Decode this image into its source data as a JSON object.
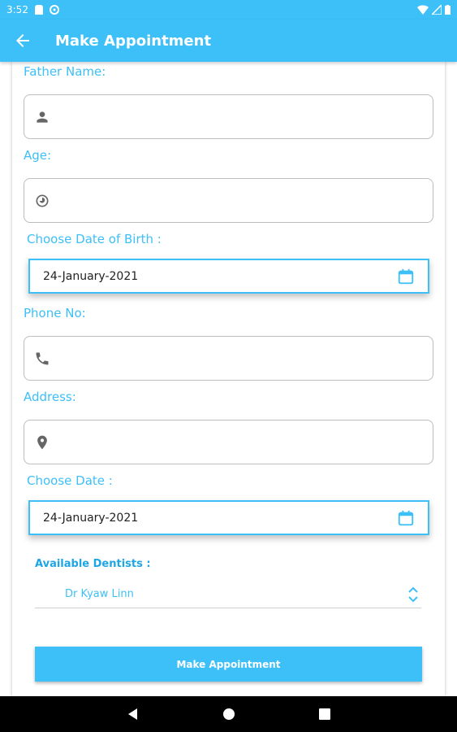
{
  "status_bar": {
    "time": "3:52"
  },
  "app_bar": {
    "title": "Make Appointment",
    "back_icon": "arrow-back-icon"
  },
  "form": {
    "father_name_label": "Father Name:",
    "father_name_icon": "person-icon",
    "father_name_value": "",
    "age_label": "Age:",
    "age_icon": "age-icon",
    "age_value": "",
    "dob_label": "Choose Date of Birth :",
    "dob_value": "24-January-2021",
    "phone_label": "Phone No:",
    "phone_icon": "phone-icon",
    "phone_value": "",
    "address_label": "Address:",
    "address_icon": "location-pin-icon",
    "address_value": "",
    "date_label": "Choose Date :",
    "date_value": "24-January-2021",
    "dentists_label": "Available Dentists :",
    "dentist_selected": "Dr Kyaw Linn",
    "submit_label": "Make Appointment"
  },
  "colors": {
    "accent": "#3dbff7",
    "border": "#bdbdbd"
  }
}
